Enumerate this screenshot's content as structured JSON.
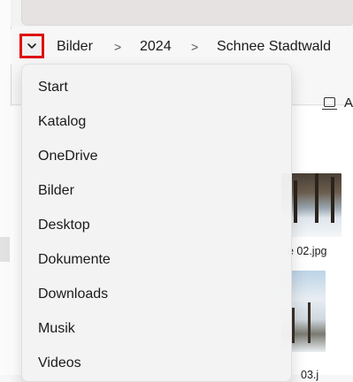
{
  "breadcrumb": {
    "expand_icon": "chevron-down-icon",
    "items": [
      "Bilder",
      "2024",
      "Schnee Stadtwald"
    ],
    "separator": ">"
  },
  "toolbar": {
    "view_icon": "view-icon",
    "partial_label": "A"
  },
  "dropdown": {
    "items": [
      "Start",
      "Katalog",
      "OneDrive",
      "Bilder",
      "Desktop",
      "Dokumente",
      "Downloads",
      "Musik",
      "Videos"
    ]
  },
  "files": [
    {
      "label_fragment": "e 02.jpg"
    },
    {
      "label_fragment": "03.j"
    }
  ],
  "colors": {
    "highlight_border": "#e01010",
    "menu_background": "#f3f3f3",
    "window_background": "#f7f7f7"
  }
}
